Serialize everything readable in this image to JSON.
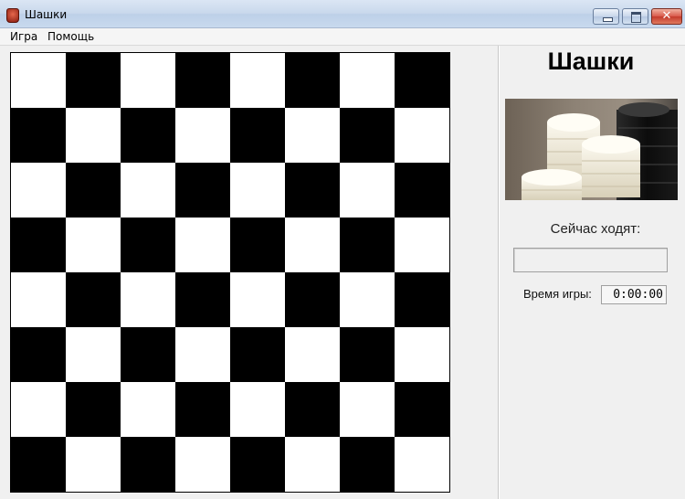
{
  "window": {
    "title": "Шашки",
    "app_icon": "checker-stack-icon",
    "controls": [
      "minimize-icon",
      "maximize-icon",
      "close-icon"
    ],
    "close_glyph": "✕"
  },
  "menu": {
    "items": [
      {
        "label": "Игра"
      },
      {
        "label": "Помощь"
      }
    ]
  },
  "board": {
    "rows": 8,
    "cols": 8,
    "top_left_color": "white",
    "colors": {
      "dark": "#000000",
      "light": "#ffffff"
    }
  },
  "panel": {
    "heading": "Шашки",
    "image": "stacked-checkers-photo",
    "current_turn_label": "Сейчас ходят:",
    "current_turn_value": "",
    "game_time_label": "Время игры:",
    "game_time_value": "0:00:00"
  }
}
